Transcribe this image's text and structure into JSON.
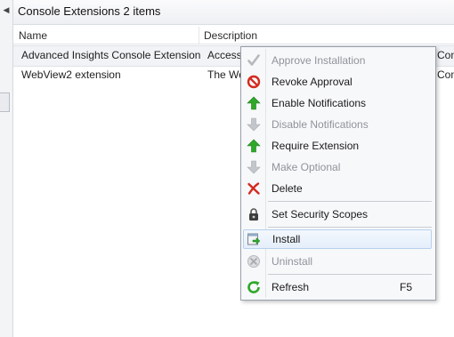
{
  "header": {
    "title": "Console Extensions 2 items"
  },
  "columns": [
    "Name",
    "Description"
  ],
  "rows": [
    {
      "name": "Advanced Insights Console Extension",
      "description": "Access",
      "extra": "Cons"
    },
    {
      "name": "WebView2 extension",
      "description": "The We",
      "extra": "Com"
    }
  ],
  "context_menu": {
    "items": [
      {
        "label": "Approve Installation",
        "icon": "checkmark-icon",
        "enabled": false
      },
      {
        "label": "Revoke Approval",
        "icon": "no-entry-icon",
        "enabled": true
      },
      {
        "label": "Enable Notifications",
        "icon": "arrow-up-icon",
        "enabled": true
      },
      {
        "label": "Disable Notifications",
        "icon": "arrow-down-icon",
        "enabled": false
      },
      {
        "label": "Require Extension",
        "icon": "arrow-up-icon",
        "enabled": true
      },
      {
        "label": "Make Optional",
        "icon": "arrow-down-icon",
        "enabled": false
      },
      {
        "label": "Delete",
        "icon": "delete-x-icon",
        "enabled": true
      },
      {
        "label": "Set Security Scopes",
        "icon": "lock-icon",
        "enabled": true
      },
      {
        "label": "Install",
        "icon": "install-icon",
        "enabled": true,
        "highlighted": true
      },
      {
        "label": "Uninstall",
        "icon": "uninstall-icon",
        "enabled": false
      },
      {
        "label": "Refresh",
        "icon": "refresh-icon",
        "enabled": true,
        "shortcut": "F5"
      }
    ]
  },
  "colors": {
    "enabled_green": "#2fa82a",
    "disabled_gray": "#b5b8bd",
    "revoke_red": "#d42a1e",
    "highlight": "#e4eefa"
  }
}
